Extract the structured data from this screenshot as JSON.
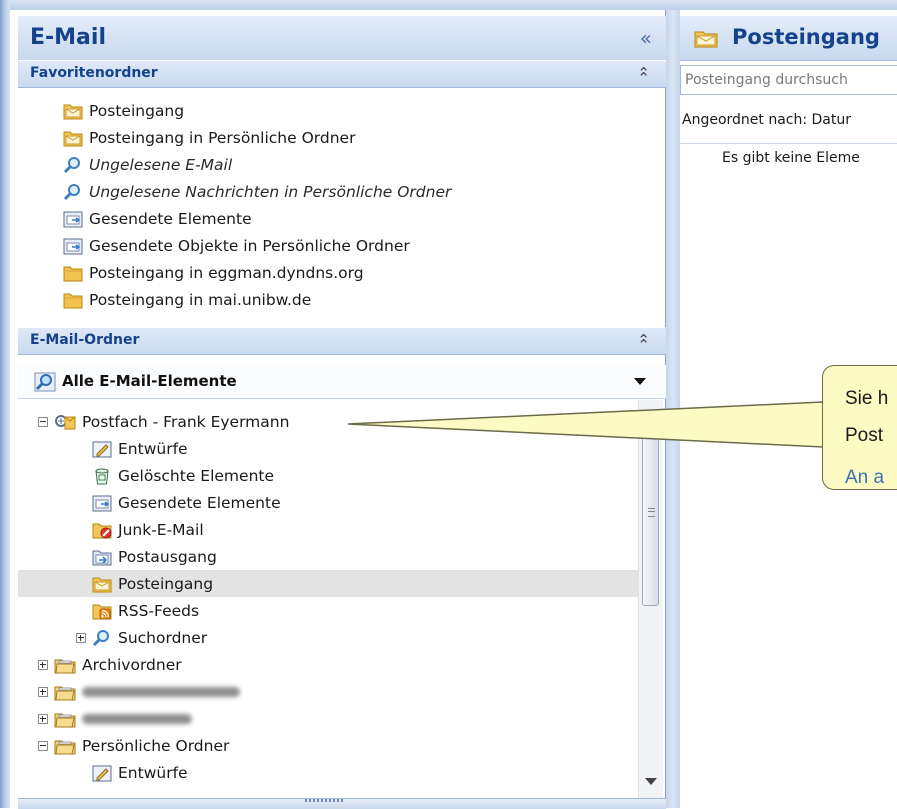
{
  "nav": {
    "title": "E-Mail",
    "collapse_glyph": "«",
    "favorites": {
      "header": "Favoritenordner",
      "items": [
        {
          "label": "Posteingang",
          "icon": "inbox-folder-icon",
          "italic": false
        },
        {
          "label": "Posteingang in Persönliche Ordner",
          "icon": "inbox-folder-icon",
          "italic": false
        },
        {
          "label": "Ungelesene E-Mail",
          "icon": "search-folder-icon",
          "italic": true
        },
        {
          "label": "Ungelesene Nachrichten in Persönliche Ordner",
          "icon": "search-folder-icon",
          "italic": true
        },
        {
          "label": "Gesendete Elemente",
          "icon": "sent-items-icon",
          "italic": false
        },
        {
          "label": "Gesendete Objekte in Persönliche Ordner",
          "icon": "sent-items-icon",
          "italic": false
        },
        {
          "label": "Posteingang in eggman.dyndns.org",
          "icon": "folder-icon",
          "italic": false
        },
        {
          "label": "Posteingang in mai.unibw.de",
          "icon": "folder-icon",
          "italic": false
        }
      ]
    },
    "mail_folders": {
      "header": "E-Mail-Ordner",
      "selector_label": "Alle E-Mail-Elemente",
      "tree": [
        {
          "label": "Postfach - Frank Eyermann",
          "icon": "mailbox-icon",
          "level": 0,
          "expander": "minus"
        },
        {
          "label": "Entwürfe",
          "icon": "drafts-icon",
          "level": 1,
          "expander": ""
        },
        {
          "label": "Gelöschte Elemente",
          "icon": "deleted-items-icon",
          "level": 1,
          "expander": ""
        },
        {
          "label": "Gesendete Elemente",
          "icon": "sent-items-icon",
          "level": 1,
          "expander": ""
        },
        {
          "label": "Junk-E-Mail",
          "icon": "junk-mail-icon",
          "level": 1,
          "expander": ""
        },
        {
          "label": "Postausgang",
          "icon": "outbox-icon",
          "level": 1,
          "expander": ""
        },
        {
          "label": "Posteingang",
          "icon": "inbox-folder-icon",
          "level": 1,
          "expander": "",
          "selected": true
        },
        {
          "label": "RSS-Feeds",
          "icon": "rss-feeds-icon",
          "level": 1,
          "expander": ""
        },
        {
          "label": "Suchordner",
          "icon": "search-folder-icon",
          "level": 1,
          "expander": "plus"
        },
        {
          "label": "Archivordner",
          "icon": "archive-folder-icon",
          "level": 0,
          "expander": "plus"
        },
        {
          "label": "",
          "icon": "archive-folder-icon",
          "level": 0,
          "expander": "plus",
          "redacted": true
        },
        {
          "label": "",
          "icon": "archive-folder-icon",
          "level": 0,
          "expander": "plus",
          "redacted": true
        },
        {
          "label": "Persönliche Ordner",
          "icon": "archive-folder-icon",
          "level": 0,
          "expander": "minus"
        },
        {
          "label": "Entwürfe",
          "icon": "drafts-icon",
          "level": 1,
          "expander": ""
        }
      ]
    }
  },
  "content": {
    "title": "Posteingang",
    "search_placeholder": "Posteingang durchsuch",
    "arranged_by": "Angeordnet nach: Datur",
    "empty_text": "Es gibt keine Eleme"
  },
  "callout": {
    "line1": "Sie h",
    "line2": "Post",
    "line3": "An a"
  },
  "colors": {
    "header_text": "#15428b",
    "callout_bg": "#fdfbc4",
    "callout_link": "#3e6fb5",
    "selected_row": "#e3e3e3"
  }
}
